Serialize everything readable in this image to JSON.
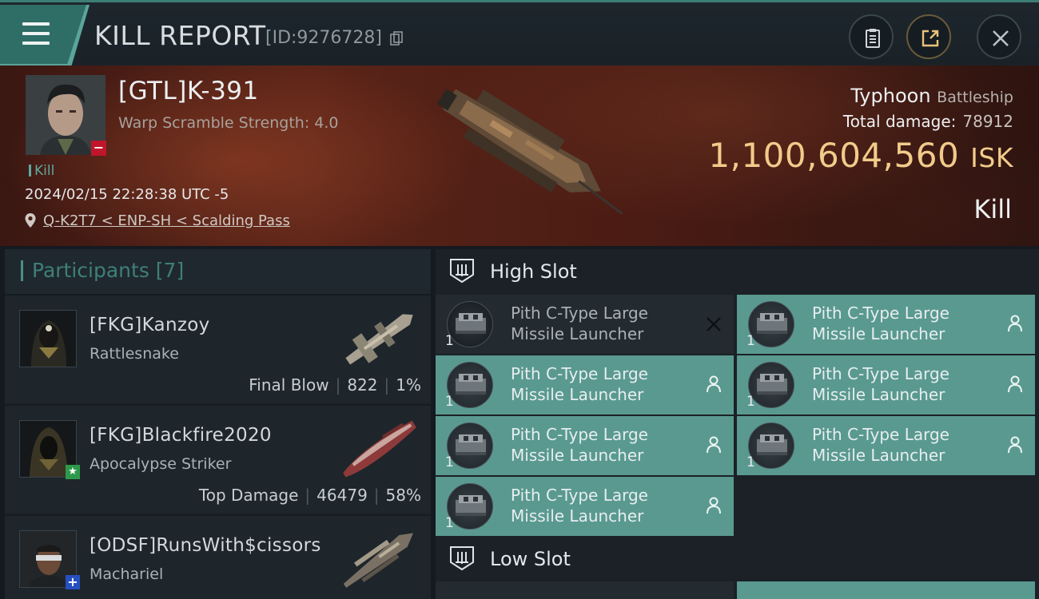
{
  "header": {
    "title": "KILL REPORT",
    "report_id": "[ID:9276728]"
  },
  "victim": {
    "name": "[GTL]K-391",
    "scramble": "Warp Scramble Strength: 4.0",
    "tag": "Kill",
    "datetime": "2024/02/15 22:28:38 UTC -5",
    "location": "Q-K2T7 < ENP-SH < Scalding Pass",
    "ship_name": "Typhoon",
    "ship_class": "Battleship",
    "total_damage_label": "Total damage:",
    "total_damage": "78912",
    "isk_value": "1,100,604,560",
    "isk_unit": "ISK",
    "result": "Kill"
  },
  "participants": {
    "title": "Participants [7]",
    "rows": [
      {
        "name": "[FKG]Kanzoy",
        "ship": "Rattlesnake",
        "role": "Final Blow",
        "damage": "822",
        "percent": "1%"
      },
      {
        "name": "[FKG]Blackfire2020",
        "ship": "Apocalypse Striker",
        "role": "Top Damage",
        "damage": "46479",
        "percent": "58%"
      },
      {
        "name": "[ODSF]RunsWith$cissors",
        "ship": "Machariel"
      }
    ]
  },
  "high_slot": {
    "title": "High Slot",
    "items": [
      {
        "line1": "Pith C-Type Large",
        "line2": "Missile Launcher",
        "qty": "1",
        "status": "destroyed"
      },
      {
        "line1": "Pith C-Type Large",
        "line2": "Missile Launcher",
        "qty": "1",
        "status": "dropped"
      },
      {
        "line1": "Pith C-Type Large",
        "line2": "Missile Launcher",
        "qty": "1",
        "status": "dropped"
      },
      {
        "line1": "Pith C-Type Large",
        "line2": "Missile Launcher",
        "qty": "1",
        "status": "dropped"
      },
      {
        "line1": "Pith C-Type Large",
        "line2": "Missile Launcher",
        "qty": "1",
        "status": "dropped"
      },
      {
        "line1": "Pith C-Type Large",
        "line2": "Missile Launcher",
        "qty": "1",
        "status": "dropped"
      },
      {
        "line1": "Pith C-Type Large",
        "line2": "Missile Launcher",
        "qty": "1",
        "status": "dropped"
      }
    ]
  },
  "low_slot": {
    "title": "Low Slot"
  },
  "colors": {
    "accent_teal": "#5a9990",
    "isk_gold": "#f1cb8a",
    "banner_red": "#5a2418"
  },
  "icons": [
    "menu-icon",
    "copy-icon",
    "clipboard-icon",
    "share-icon",
    "close-icon",
    "location-pin-icon",
    "slot-icon",
    "module-icon",
    "person-icon",
    "x-icon"
  ]
}
